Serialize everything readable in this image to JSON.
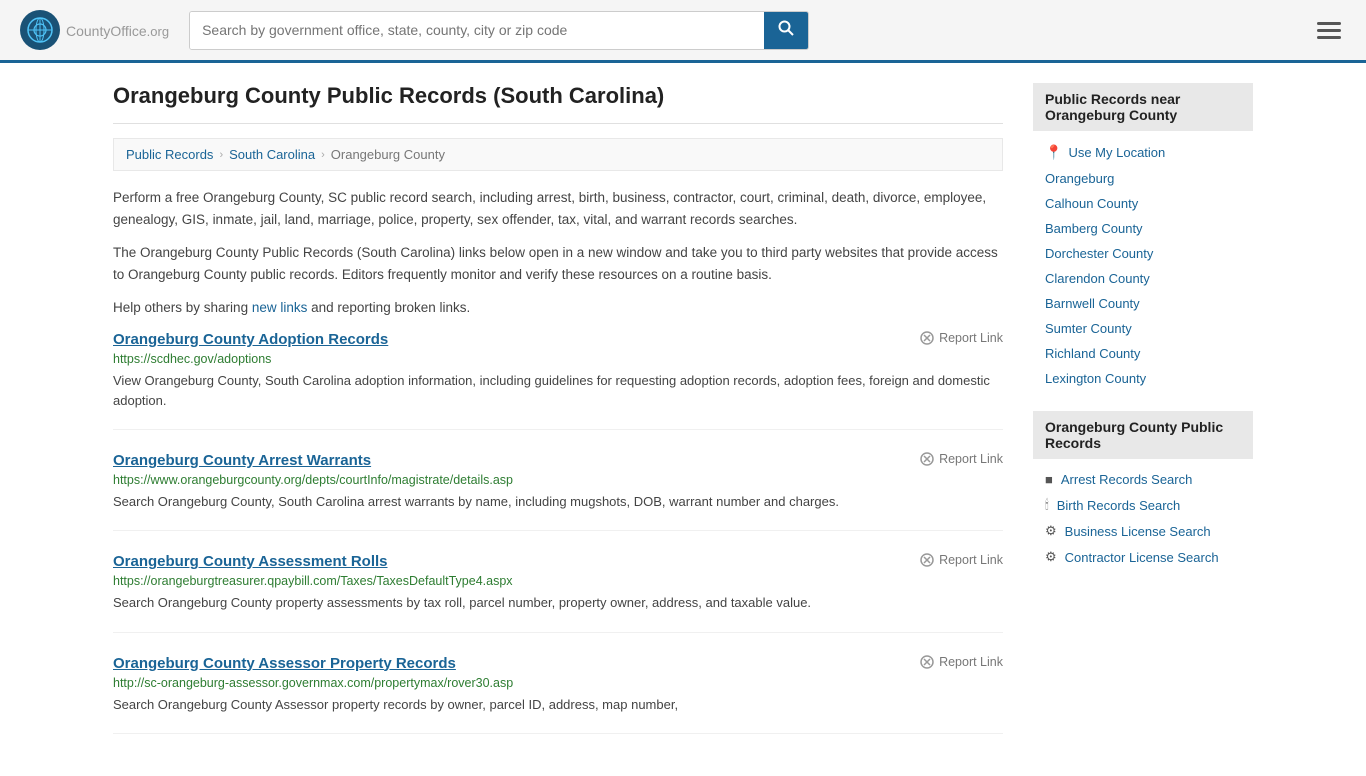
{
  "header": {
    "logo_text": "CountyOffice",
    "logo_suffix": ".org",
    "search_placeholder": "Search by government office, state, county, city or zip code",
    "menu_label": "Menu"
  },
  "page": {
    "title": "Orangeburg County Public Records (South Carolina)",
    "breadcrumb": [
      "Public Records",
      "South Carolina",
      "Orangeburg County"
    ],
    "description1": "Perform a free Orangeburg County, SC public record search, including arrest, birth, business, contractor, court, criminal, death, divorce, employee, genealogy, GIS, inmate, jail, land, marriage, police, property, sex offender, tax, vital, and warrant records searches.",
    "description2": "The Orangeburg County Public Records (South Carolina) links below open in a new window and take you to third party websites that provide access to Orangeburg County public records. Editors frequently monitor and verify these resources on a routine basis.",
    "description3": "Help others by sharing",
    "new_links": "new links",
    "description3b": "and reporting broken links."
  },
  "records": [
    {
      "title": "Orangeburg County Adoption Records",
      "url": "https://scdhec.gov/adoptions",
      "description": "View Orangeburg County, South Carolina adoption information, including guidelines for requesting adoption records, adoption fees, foreign and domestic adoption.",
      "report_label": "Report Link"
    },
    {
      "title": "Orangeburg County Arrest Warrants",
      "url": "https://www.orangeburgcounty.org/depts/courtInfo/magistrate/details.asp",
      "description": "Search Orangeburg County, South Carolina arrest warrants by name, including mugshots, DOB, warrant number and charges.",
      "report_label": "Report Link"
    },
    {
      "title": "Orangeburg County Assessment Rolls",
      "url": "https://orangeburgtreasurer.qpaybill.com/Taxes/TaxesDefaultType4.aspx",
      "description": "Search Orangeburg County property assessments by tax roll, parcel number, property owner, address, and taxable value.",
      "report_label": "Report Link"
    },
    {
      "title": "Orangeburg County Assessor Property Records",
      "url": "http://sc-orangeburg-assessor.governmax.com/propertymax/rover30.asp",
      "description": "Search Orangeburg County Assessor property records by owner, parcel ID, address, map number,",
      "report_label": "Report Link"
    }
  ],
  "sidebar": {
    "nearby_title": "Public Records near Orangeburg County",
    "use_location": "Use My Location",
    "nearby_links": [
      "Orangeburg",
      "Calhoun County",
      "Bamberg County",
      "Dorchester County",
      "Clarendon County",
      "Barnwell County",
      "Sumter County",
      "Richland County",
      "Lexington County"
    ],
    "records_title": "Orangeburg County Public Records",
    "records_links": [
      {
        "label": "Arrest Records Search",
        "icon": "■"
      },
      {
        "label": "Birth Records Search",
        "icon": "🕯"
      },
      {
        "label": "Business License Search",
        "icon": "⚙"
      },
      {
        "label": "Contractor License Search",
        "icon": "⚙"
      }
    ]
  }
}
